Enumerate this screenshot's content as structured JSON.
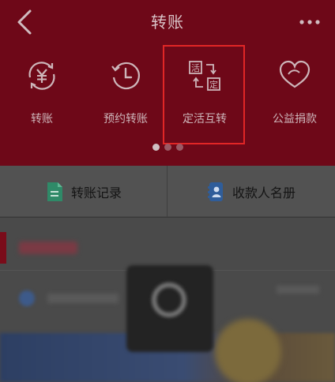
{
  "header": {
    "title": "转账",
    "back_icon": "chevron-left-icon",
    "more_icon": "more-dots-icon"
  },
  "actions": [
    {
      "label": "转账",
      "icon": "yuan-exchange-icon"
    },
    {
      "label": "预约转账",
      "icon": "clock-icon"
    },
    {
      "label": "定活互转",
      "icon": "fixed-current-swap-icon",
      "icon_text": [
        "活",
        "定"
      ]
    },
    {
      "label": "公益捐款",
      "icon": "heart-donation-icon"
    }
  ],
  "pager": {
    "pages": 3,
    "active": 1
  },
  "quick_links": [
    {
      "label": "转账记录",
      "icon": "document-icon"
    },
    {
      "label": "收款人名册",
      "icon": "contacts-book-icon"
    }
  ],
  "colors": {
    "header_bg": "#6e0818",
    "highlight_border": "#e12626",
    "quick_bar_bg": "#525252",
    "record_icon": "#2f8a68",
    "contacts_icon": "#2f5d9a"
  }
}
